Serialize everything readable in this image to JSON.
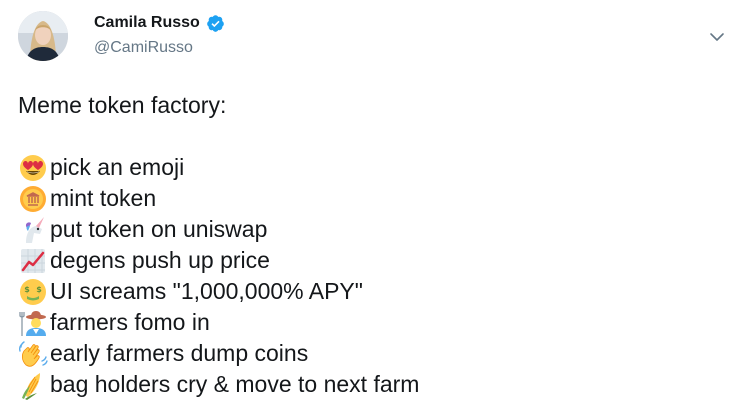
{
  "author": {
    "display_name": "Camila Russo",
    "handle": "@CamiRusso",
    "verified": true,
    "verified_color": "#1da1f2"
  },
  "menu": {
    "icon": "chevron-down-icon"
  },
  "tweet": {
    "intro": "Meme token factory:",
    "lines": [
      {
        "emoji": "heart-eyes-emoji",
        "text": "pick an emoji"
      },
      {
        "emoji": "coin-emoji",
        "text": "mint token"
      },
      {
        "emoji": "unicorn-emoji",
        "text": "put token on uniswap"
      },
      {
        "emoji": "chart-increasing-emoji",
        "text": "degens push up price"
      },
      {
        "emoji": "money-mouth-emoji",
        "text": "UI screams \"1,000,000% APY\""
      },
      {
        "emoji": "farmer-emoji",
        "text": "farmers fomo in"
      },
      {
        "emoji": "waving-hand-emoji",
        "text": "early farmers dump coins"
      },
      {
        "emoji": "corn-emoji",
        "text": "bag holders cry & move to next farm"
      }
    ]
  },
  "colors": {
    "text": "#14171a",
    "secondary": "#657786",
    "accent": "#1da1f2"
  }
}
